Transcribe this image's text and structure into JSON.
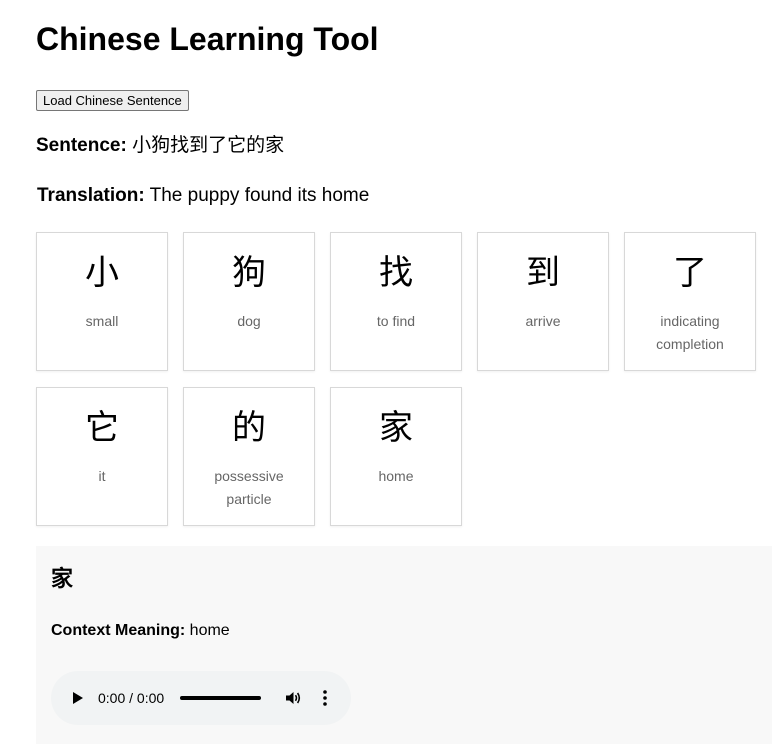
{
  "header": {
    "title": "Chinese Learning Tool"
  },
  "controls": {
    "load_button_label": "Load Chinese Sentence"
  },
  "sentence": {
    "label": "Sentence:",
    "text": "小狗找到了它的家"
  },
  "translation": {
    "label": "Translation:",
    "text": "The puppy found its home"
  },
  "cards": [
    {
      "char": "小",
      "meaning": "small"
    },
    {
      "char": "狗",
      "meaning": "dog"
    },
    {
      "char": "找",
      "meaning": "to find"
    },
    {
      "char": "到",
      "meaning": "arrive"
    },
    {
      "char": "了",
      "meaning": "indicating completion"
    },
    {
      "char": "它",
      "meaning": "it"
    },
    {
      "char": "的",
      "meaning": "possessive particle"
    },
    {
      "char": "家",
      "meaning": "home"
    }
  ],
  "detail": {
    "char": "家",
    "meaning_label": "Context Meaning:",
    "meaning": "home"
  },
  "audio": {
    "time_display": "0:00 / 0:00",
    "progress": 0,
    "icons": [
      "play-icon",
      "volume-icon",
      "more-vertical-icon"
    ]
  },
  "colors": {
    "card_border": "#d8d8d8",
    "meaning_text": "#666666",
    "panel_background": "#f8f8f8",
    "player_background": "#f1f3f4"
  }
}
